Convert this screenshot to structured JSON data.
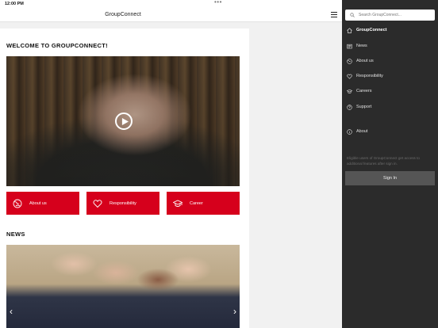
{
  "status": {
    "time": "12:00 PM",
    "dots": "•••"
  },
  "appbar": {
    "title": "GroupConnect"
  },
  "content": {
    "welcome_title": "WELCOME TO GROUPCONNECT!",
    "tiles": [
      {
        "label": "About us",
        "icon": "globe-icon"
      },
      {
        "label": "Responsibility",
        "icon": "heart-icon"
      },
      {
        "label": "Career",
        "icon": "graduation-cap-icon"
      }
    ],
    "news_title": "NEWS",
    "carousel": {
      "prev": "‹",
      "next": "›"
    }
  },
  "drawer": {
    "search_placeholder": "Search GroupConnect...",
    "items": [
      {
        "label": "GroupConnect",
        "icon": "home-icon",
        "active": true
      },
      {
        "label": "News",
        "icon": "newspaper-icon"
      },
      {
        "label": "About us",
        "icon": "globe-icon"
      },
      {
        "label": "Responsibility",
        "icon": "heart-icon"
      },
      {
        "label": "Careers",
        "icon": "graduation-cap-icon"
      },
      {
        "label": "Support",
        "icon": "help-icon"
      },
      {
        "label": "About",
        "icon": "info-icon"
      }
    ],
    "signin_text": "Eligible users of GroupConnect get access to additional features after sign in.",
    "signin_label": "Sign In"
  },
  "colors": {
    "accent": "#d6001c",
    "drawer_bg": "#2b2b2b",
    "signin_btn": "#555555"
  }
}
